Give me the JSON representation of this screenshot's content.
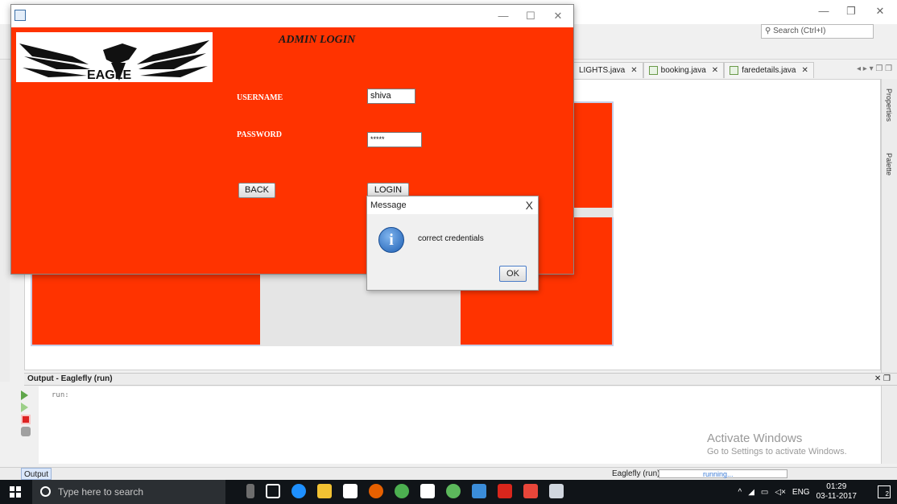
{
  "ide": {
    "search_placeholder": "Search (Ctrl+I)",
    "tabs": [
      {
        "label": "LIGHTS.java"
      },
      {
        "label": "booking.java"
      },
      {
        "label": "faredetails.java"
      }
    ],
    "properties_label": "Properties",
    "palette_label": "Palette",
    "output": {
      "header": "Output - Eaglefly (run)",
      "log": "run:"
    },
    "activate": {
      "title": "Activate Windows",
      "subtitle": "Go to Settings to activate Windows."
    },
    "status": {
      "output_tab": "Output",
      "project_run": "Eaglefly (run)",
      "progress_text": "running..."
    }
  },
  "login_window": {
    "logo_text": "EAGLE",
    "title": "ADMIN LOGIN",
    "username_label": "USERNAME",
    "username_value": "shiva",
    "password_label": "PASSWORD",
    "password_value": "*****",
    "back_button": "BACK",
    "login_button": "LOGIN"
  },
  "message_dialog": {
    "title": "Message",
    "text": "correct credentials",
    "ok_button": "OK",
    "close_glyph": "X"
  },
  "taskbar": {
    "search_placeholder": "Type here to search",
    "language": "ENG",
    "time": "01:29",
    "date": "03-11-2017",
    "notification_count": "2"
  },
  "colors": {
    "form_background": "#ff3300",
    "taskbar": "#101418"
  }
}
